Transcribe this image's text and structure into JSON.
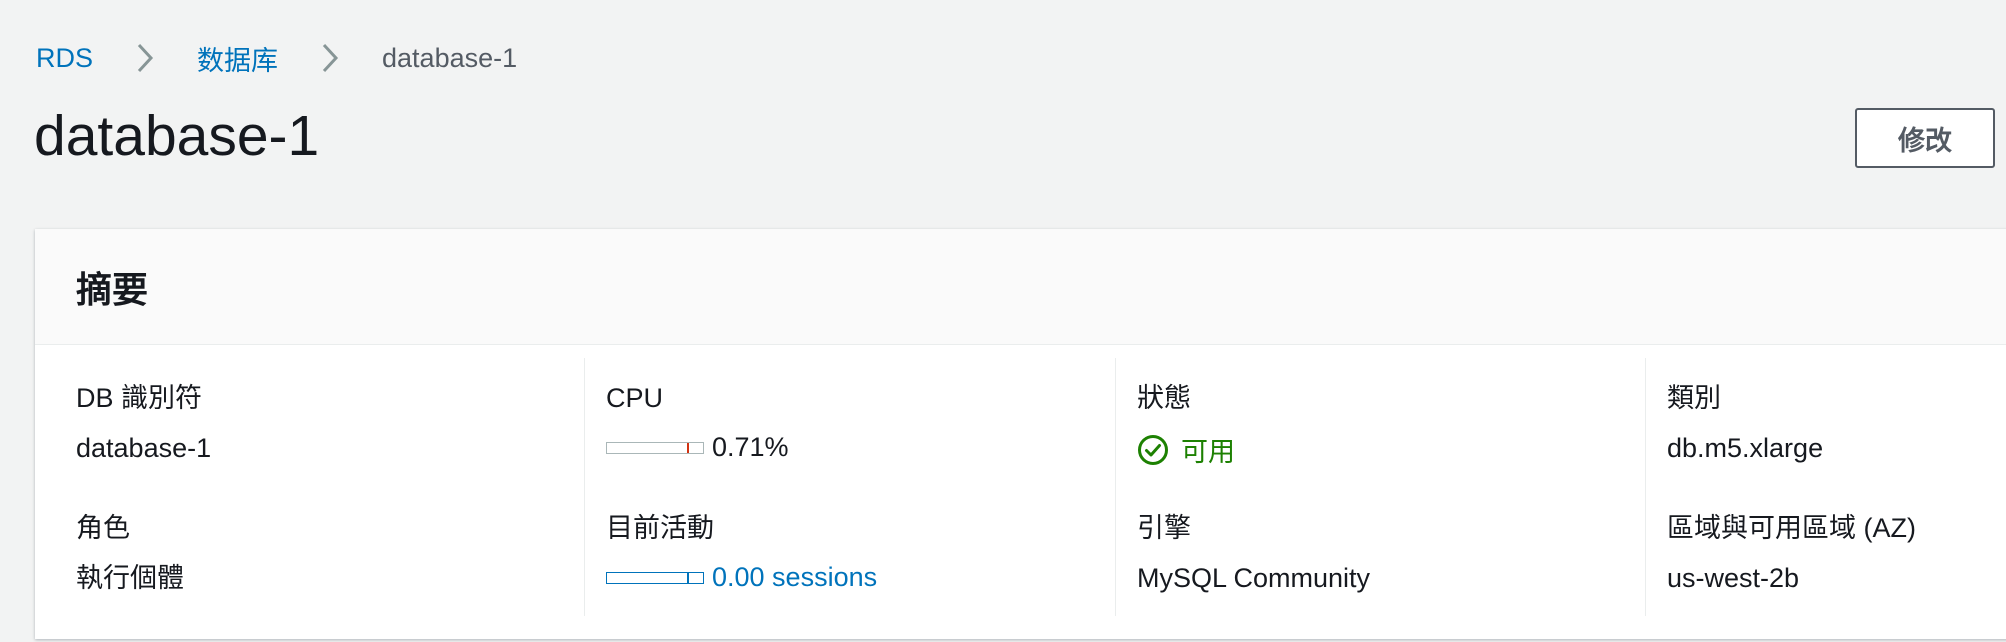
{
  "breadcrumb": {
    "items": [
      {
        "label": "RDS"
      },
      {
        "label": "数据库"
      },
      {
        "label": "database-1"
      }
    ]
  },
  "page": {
    "title": "database-1",
    "modify_label": "修改"
  },
  "summary": {
    "title": "摘要",
    "db_identifier": {
      "label": "DB 識別符",
      "value": "database-1"
    },
    "role": {
      "label": "角色",
      "value": "執行個體"
    },
    "cpu": {
      "label": "CPU",
      "value": "0.71%",
      "level_percent": 0.71
    },
    "current_activity": {
      "label": "目前活動",
      "value": "0.00 sessions",
      "level": 0.0
    },
    "status": {
      "label": "狀態",
      "value": "可用",
      "icon": "check-circle-icon"
    },
    "engine": {
      "label": "引擎",
      "value": "MySQL Community"
    },
    "class": {
      "label": "類別",
      "value": "db.m5.xlarge"
    },
    "region_az": {
      "label": "區域與可用區域 (AZ)",
      "value": "us-west-2b"
    }
  },
  "colors": {
    "link": "#0073bb",
    "status_ok": "#1d8102",
    "meter_tick_cpu": "#d13212",
    "background": "#f2f3f3"
  }
}
